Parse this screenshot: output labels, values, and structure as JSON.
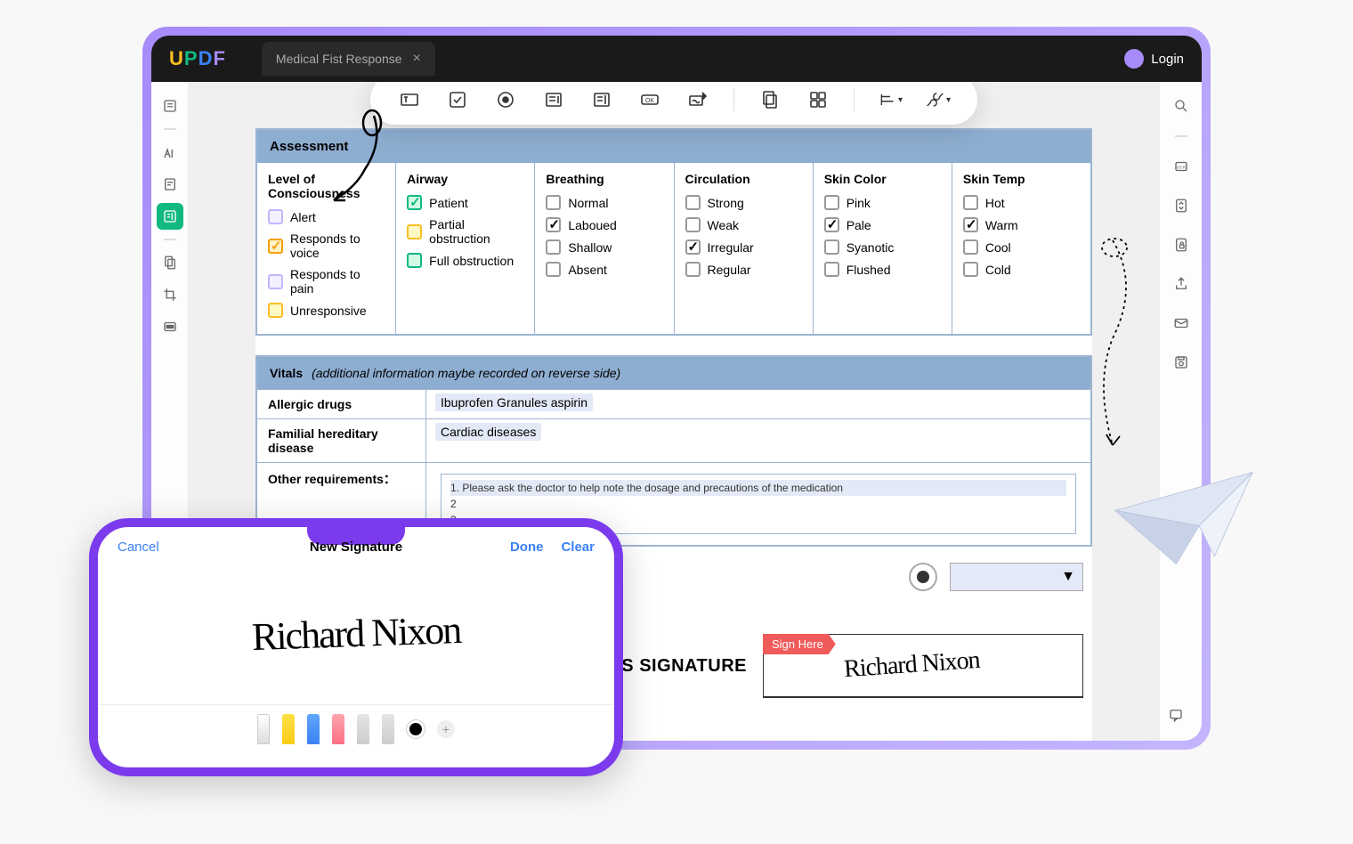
{
  "titlebar": {
    "tab_name": "Medical Fist Response",
    "login": "Login"
  },
  "assessment": {
    "title": "Assessment",
    "columns": [
      {
        "title": "Level of Consciousness",
        "items": [
          {
            "label": "Alert",
            "style": "p-purple",
            "checked": false
          },
          {
            "label": "Responds to voice",
            "style": "p-orange",
            "checked": true
          },
          {
            "label": "Responds to pain",
            "style": "p-purple",
            "checked": false
          },
          {
            "label": "Unresponsive",
            "style": "p-yellow",
            "checked": false
          }
        ]
      },
      {
        "title": "Airway",
        "items": [
          {
            "label": "Patient",
            "style": "p-green",
            "checked": true
          },
          {
            "label": "Partial obstruction",
            "style": "p-yellow",
            "checked": false
          },
          {
            "label": "Full obstruction",
            "style": "p-green",
            "checked": false
          }
        ]
      },
      {
        "title": "Breathing",
        "items": [
          {
            "label": "Normal",
            "style": "",
            "checked": false
          },
          {
            "label": "Laboued",
            "style": "",
            "checked": true
          },
          {
            "label": "Shallow",
            "style": "",
            "checked": false
          },
          {
            "label": "Absent",
            "style": "",
            "checked": false
          }
        ]
      },
      {
        "title": "Circulation",
        "items": [
          {
            "label": "Strong",
            "style": "",
            "checked": false
          },
          {
            "label": "Weak",
            "style": "",
            "checked": false
          },
          {
            "label": "Irregular",
            "style": "",
            "checked": true
          },
          {
            "label": "Regular",
            "style": "",
            "checked": false
          }
        ]
      },
      {
        "title": "Skin Color",
        "items": [
          {
            "label": "Pink",
            "style": "",
            "checked": false
          },
          {
            "label": "Pale",
            "style": "",
            "checked": true
          },
          {
            "label": "Syanotic",
            "style": "",
            "checked": false
          },
          {
            "label": "Flushed",
            "style": "",
            "checked": false
          }
        ]
      },
      {
        "title": "Skin Temp",
        "items": [
          {
            "label": "Hot",
            "style": "",
            "checked": false
          },
          {
            "label": "Warm",
            "style": "",
            "checked": true
          },
          {
            "label": "Cool",
            "style": "",
            "checked": false
          },
          {
            "label": "Cold",
            "style": "",
            "checked": false
          }
        ]
      }
    ]
  },
  "vitals": {
    "title": "Vitals",
    "subtitle": "(additional information maybe recorded on reverse side)",
    "rows": [
      {
        "label": "Allergic drugs",
        "value": "Ibuprofen Granules  aspirin"
      },
      {
        "label": "Familial hereditary disease",
        "value": "Cardiac diseases"
      }
    ],
    "other_label": "Other requirements：",
    "other_lines": [
      "1. Please ask the doctor to help note the dosage and precautions of the medication",
      "2",
      "3"
    ]
  },
  "signature": {
    "label": "T'S SIGNATURE",
    "sign_here": "Sign Here",
    "cursive": "Richard Nixon"
  },
  "phone": {
    "cancel": "Cancel",
    "title": "New Signature",
    "done": "Done",
    "clear": "Clear",
    "cursive": "Richard Nixon"
  }
}
